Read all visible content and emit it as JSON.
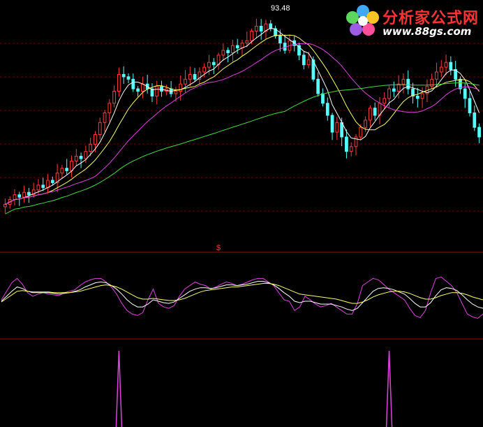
{
  "chart_data": [
    {
      "type": "candlestick",
      "title": "",
      "price_label": "93.48",
      "legend": "none",
      "grid": "horizontal dashed",
      "colors": {
        "up": "#ff3b3b",
        "down": "#55ffff",
        "ma_fast": "#ffffff",
        "ma_mid": "#ffff66",
        "ma_slow": "#dd44dd",
        "ma_long": "#44dd44",
        "grid": "#6a0000"
      },
      "close": [
        18,
        20,
        22,
        21,
        23,
        22,
        24,
        26,
        25,
        28,
        27,
        31,
        33,
        32,
        36,
        38,
        37,
        40,
        43,
        47,
        52,
        56,
        60,
        65,
        72,
        71,
        70,
        66,
        65,
        68,
        66,
        63,
        67,
        65,
        66,
        64,
        65,
        68,
        70,
        72,
        70,
        73,
        75,
        77,
        76,
        80,
        82,
        81,
        84,
        83,
        85,
        86,
        90,
        92,
        90,
        93,
        91,
        88,
        85,
        82,
        86,
        84,
        80,
        76,
        78,
        70,
        64,
        60,
        55,
        48,
        52,
        46,
        40,
        42,
        46,
        50,
        53,
        58,
        55,
        60,
        62,
        66,
        65,
        68,
        70,
        66,
        63,
        62,
        64,
        67,
        70,
        73,
        75,
        77,
        74,
        70,
        66,
        62,
        56,
        50,
        46
      ]
    },
    {
      "type": "line",
      "title": "",
      "marker_label": "$",
      "series": [
        {
          "color": "#dd44dd",
          "values": [
            50,
            62,
            74,
            80,
            72,
            60,
            55,
            58,
            60,
            58,
            57,
            56,
            60,
            62,
            64,
            70,
            75,
            78,
            80,
            80,
            75,
            68,
            58,
            45,
            35,
            30,
            28,
            32,
            50,
            65,
            45,
            40,
            38,
            42,
            55,
            65,
            70,
            75,
            72,
            70,
            65,
            68,
            72,
            75,
            73,
            70,
            72,
            75,
            78,
            80,
            80,
            75,
            70,
            60,
            50,
            48,
            35,
            40,
            55,
            50,
            44,
            40,
            42,
            45,
            40,
            35,
            30,
            30,
            45,
            70,
            75,
            80,
            78,
            72,
            65,
            60,
            55,
            50,
            38,
            28,
            25,
            35,
            60,
            80,
            82,
            76,
            70,
            60,
            45,
            30,
            26,
            24,
            30
          ]
        },
        {
          "color": "#ffffff",
          "values": [
            48,
            55,
            62,
            68,
            66,
            62,
            60,
            60,
            60,
            60,
            59,
            58,
            59,
            60,
            62,
            64,
            68,
            71,
            74,
            75,
            74,
            70,
            65,
            58,
            50,
            44,
            40,
            40,
            44,
            50,
            48,
            46,
            45,
            47,
            52,
            57,
            62,
            65,
            67,
            67,
            66,
            67,
            69,
            71,
            71,
            70,
            71,
            72,
            74,
            76,
            76,
            74,
            71,
            66,
            60,
            55,
            48,
            46,
            48,
            48,
            46,
            44,
            44,
            44,
            42,
            40,
            37,
            35,
            38,
            46,
            54,
            62,
            66,
            67,
            66,
            64,
            61,
            58,
            52,
            45,
            40,
            40,
            46,
            56,
            64,
            67,
            66,
            63,
            57,
            50,
            44,
            40,
            38
          ]
        },
        {
          "color": "#ffff66",
          "values": [
            47,
            52,
            57,
            62,
            63,
            62,
            61,
            61,
            61,
            61,
            60,
            60,
            60,
            60,
            61,
            62,
            64,
            66,
            68,
            70,
            71,
            70,
            68,
            65,
            61,
            57,
            53,
            51,
            51,
            52,
            51,
            50,
            49,
            49,
            50,
            52,
            55,
            58,
            61,
            63,
            64,
            65,
            66,
            67,
            68,
            68,
            69,
            70,
            71,
            72,
            73,
            73,
            72,
            70,
            67,
            64,
            61,
            58,
            57,
            56,
            55,
            54,
            53,
            52,
            51,
            49,
            47,
            45,
            45,
            47,
            50,
            54,
            57,
            59,
            61,
            62,
            62,
            61,
            59,
            56,
            53,
            51,
            51,
            53,
            56,
            58,
            60,
            60,
            59,
            57,
            54,
            52,
            50
          ]
        }
      ]
    },
    {
      "type": "line",
      "title": "",
      "series": [
        {
          "color": "#dd44dd",
          "spikes": [
            24,
            81
          ]
        }
      ]
    }
  ],
  "watermark": {
    "title": "分析家公式网",
    "url": "www.88gs.com"
  }
}
